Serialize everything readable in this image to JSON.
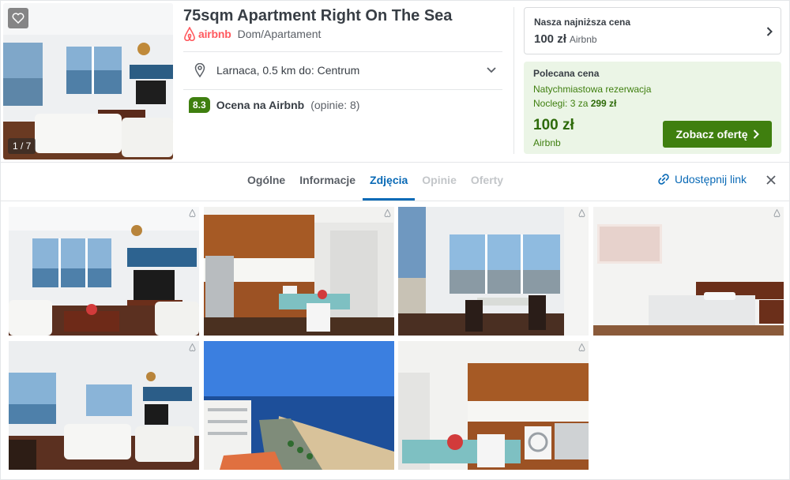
{
  "listing": {
    "title": "75sqm Apartment Right On The Sea",
    "brand": "airbnb",
    "category": "Dom/Apartament",
    "location": "Larnaca, 0.5 km do: Centrum",
    "photo_counter": "1 / 7",
    "rating": {
      "score": "8.3",
      "source": "Ocena na Airbnb",
      "count": "(opinie: 8)"
    }
  },
  "pricing": {
    "lowest": {
      "label": "Nasza najniższa cena",
      "price": "100 zł",
      "provider": "Airbnb"
    },
    "recommended": {
      "label": "Polecana cena",
      "instant": "Natychmiastowa rezerwacja",
      "nights_prefix": "Noclegi: 3 za ",
      "nights_total": "299 zł",
      "price": "100 zł",
      "provider": "Airbnb",
      "cta": "Zobacz ofertę"
    }
  },
  "tabs": [
    {
      "label": "Ogólne",
      "state": "normal"
    },
    {
      "label": "Informacje",
      "state": "normal"
    },
    {
      "label": "Zdjęcia",
      "state": "active"
    },
    {
      "label": "Opinie",
      "state": "disabled"
    },
    {
      "label": "Oferty",
      "state": "disabled"
    }
  ],
  "share": {
    "label": "Udostępnij link"
  },
  "gallery": {
    "photos": [
      {
        "subject": "living-room"
      },
      {
        "subject": "kitchen"
      },
      {
        "subject": "dining-window"
      },
      {
        "subject": "bedroom"
      },
      {
        "subject": "living-room-wide"
      },
      {
        "subject": "beach-view"
      },
      {
        "subject": "kitchen-dining"
      }
    ]
  },
  "colors": {
    "brand_green": "#3f7f0f",
    "link_blue": "#0a6ab6",
    "airbnb_red": "#ff5a5f",
    "recommended_bg": "#ebf5e6"
  },
  "icons": [
    "heart-icon",
    "airbnb-logo-icon",
    "map-pin-icon",
    "chevron-down-icon",
    "chevron-right-icon",
    "link-icon",
    "close-icon",
    "corner-brand-icon"
  ]
}
